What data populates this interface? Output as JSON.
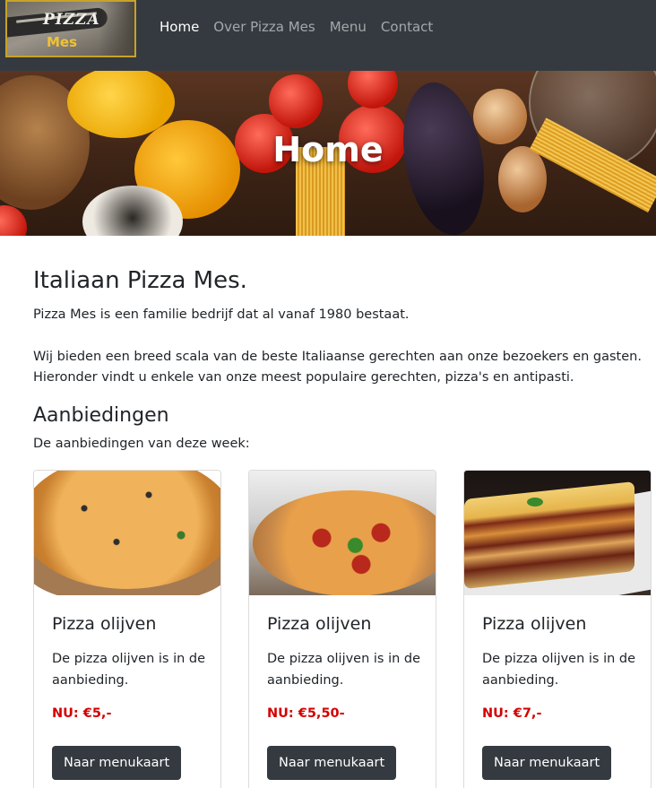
{
  "brand": {
    "logo_line1": "PIZZA",
    "logo_line2": "Mes"
  },
  "nav": {
    "items": [
      {
        "label": "Home",
        "active": true
      },
      {
        "label": "Over Pizza Mes",
        "active": false
      },
      {
        "label": "Menu",
        "active": false
      },
      {
        "label": "Contact",
        "active": false
      }
    ]
  },
  "hero": {
    "title": "Home"
  },
  "main": {
    "heading": "Italiaan Pizza Mes.",
    "intro": "Pizza Mes is een familie bedrijf dat al vanaf 1980 bestaat.",
    "description_line1": "Wij bieden een breed scala van de beste Italiaanse gerechten aan onze bezoekers en gasten.",
    "description_line2": "Hieronder vindt u enkele van onze meest populaire gerechten, pizza's en antipasti.",
    "offers_heading": "Aanbiedingen",
    "offers_intro": "De aanbiedingen van deze week:"
  },
  "cards": [
    {
      "title": "Pizza olijven",
      "text": "De pizza olijven is in de aanbieding.",
      "price": "NU: €5,-",
      "button": "Naar menukaart"
    },
    {
      "title": "Pizza olijven",
      "text": "De pizza olijven is in de aanbieding.",
      "price": "NU: €5,50-",
      "button": "Naar menukaart"
    },
    {
      "title": "Pizza olijven",
      "text": "De pizza olijven is in de aanbieding.",
      "price": "NU: €7,-",
      "button": "Naar menukaart"
    }
  ],
  "colors": {
    "navbar": "#343a40",
    "price": "#d40000",
    "button": "#343a40",
    "logo_border": "#c9a227"
  }
}
